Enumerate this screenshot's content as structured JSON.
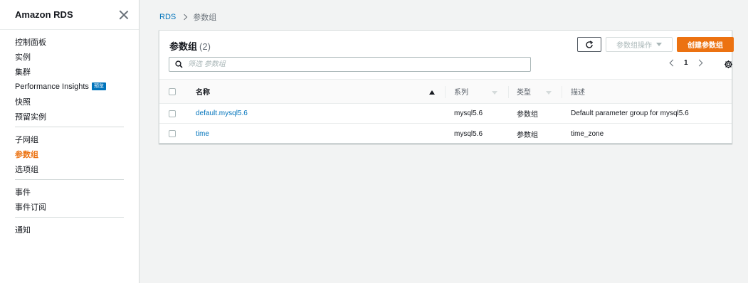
{
  "sidebar": {
    "title": "Amazon RDS",
    "sections": [
      [
        {
          "label": "控制面板"
        },
        {
          "label": "实例"
        },
        {
          "label": "集群"
        },
        {
          "label": "Performance Insights",
          "badge": "预览"
        },
        {
          "label": "快照"
        },
        {
          "label": "预留实例"
        }
      ],
      [
        {
          "label": "子网组"
        },
        {
          "label": "参数组",
          "active": true
        },
        {
          "label": "选项组"
        }
      ],
      [
        {
          "label": "事件"
        },
        {
          "label": "事件订阅"
        }
      ],
      [
        {
          "label": "通知"
        }
      ]
    ]
  },
  "breadcrumb": {
    "root": "RDS",
    "current": "参数组"
  },
  "panel": {
    "title": "参数组",
    "count": "(2)",
    "actions_label": "参数组操作",
    "create_label": "创建参数组",
    "search_placeholder": "筛选 参数组",
    "page": "1"
  },
  "table": {
    "headers": {
      "name": "名称",
      "family": "系列",
      "type": "类型",
      "description": "描述"
    },
    "rows": [
      {
        "name": "default.mysql5.6",
        "family": "mysql5.6",
        "type": "参数组",
        "description": "Default parameter group for mysql5.6"
      },
      {
        "name": "time",
        "family": "mysql5.6",
        "type": "参数组",
        "description": "time_zone"
      }
    ]
  },
  "colors": {
    "accent": "#ec7211",
    "link": "#0073bb",
    "badge": "#0073bb"
  }
}
